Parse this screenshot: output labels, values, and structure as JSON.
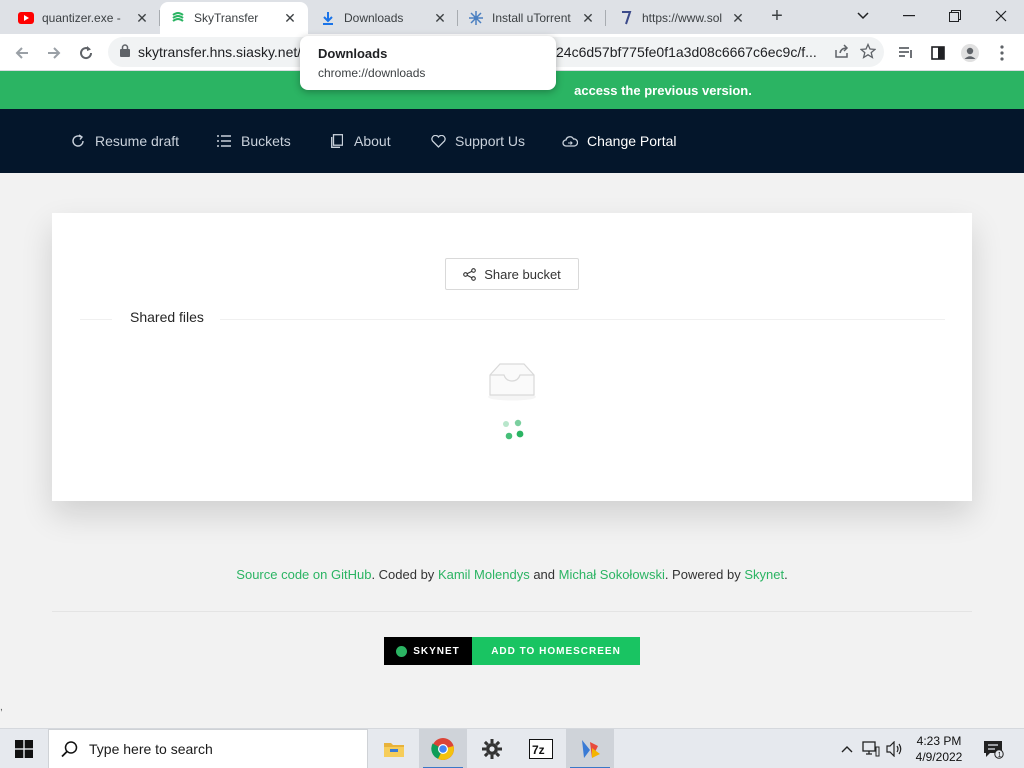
{
  "browser": {
    "tabs": [
      {
        "title": "quantizer.exe - ",
        "favicon": "youtube-icon"
      },
      {
        "title": "SkyTransfer",
        "favicon": "skytransfer-icon"
      },
      {
        "title": "Downloads",
        "favicon": "download-icon"
      },
      {
        "title": "Install uTorrent ",
        "favicon": "utorrent-icon"
      },
      {
        "title": "https://www.sol",
        "favicon": "page-icon"
      }
    ],
    "url_host": "skytransfer.hns.siasky.net/",
    "url_tail": "24c6d57bf775fe0f1a3d08c6667c6ec9c/f...",
    "hovercard": {
      "title": "Downloads",
      "subtitle": "chrome://downloads"
    }
  },
  "banner": {
    "text": "access the previous version."
  },
  "nav": {
    "items": [
      {
        "label": "Resume draft",
        "icon": "refresh-icon"
      },
      {
        "label": "Buckets",
        "icon": "list-icon"
      },
      {
        "label": "About",
        "icon": "copy-icon"
      },
      {
        "label": "Support Us",
        "icon": "heart-icon"
      },
      {
        "label": "Change Portal",
        "icon": "cloud-sync-icon"
      }
    ]
  },
  "card": {
    "share_label": "Share bucket",
    "section_title": "Shared files"
  },
  "footer": {
    "source_link": "Source code on GitHub",
    "coded_by": ". Coded by ",
    "author1": "Kamil Molendys",
    "and": " and ",
    "author2": "Michał Sokołowski",
    "powered": ". Powered by ",
    "skynet_link": "Skynet",
    "end": ".",
    "badge_left": "SKYNET",
    "badge_right": "ADD TO HOMESCREEN"
  },
  "taskbar": {
    "search_placeholder": "Type here to search",
    "time": "4:23 PM",
    "date": "4/9/2022",
    "notification_count": "1"
  },
  "colors": {
    "accent_green": "#2bb463",
    "nav_bg": "#04162b"
  }
}
